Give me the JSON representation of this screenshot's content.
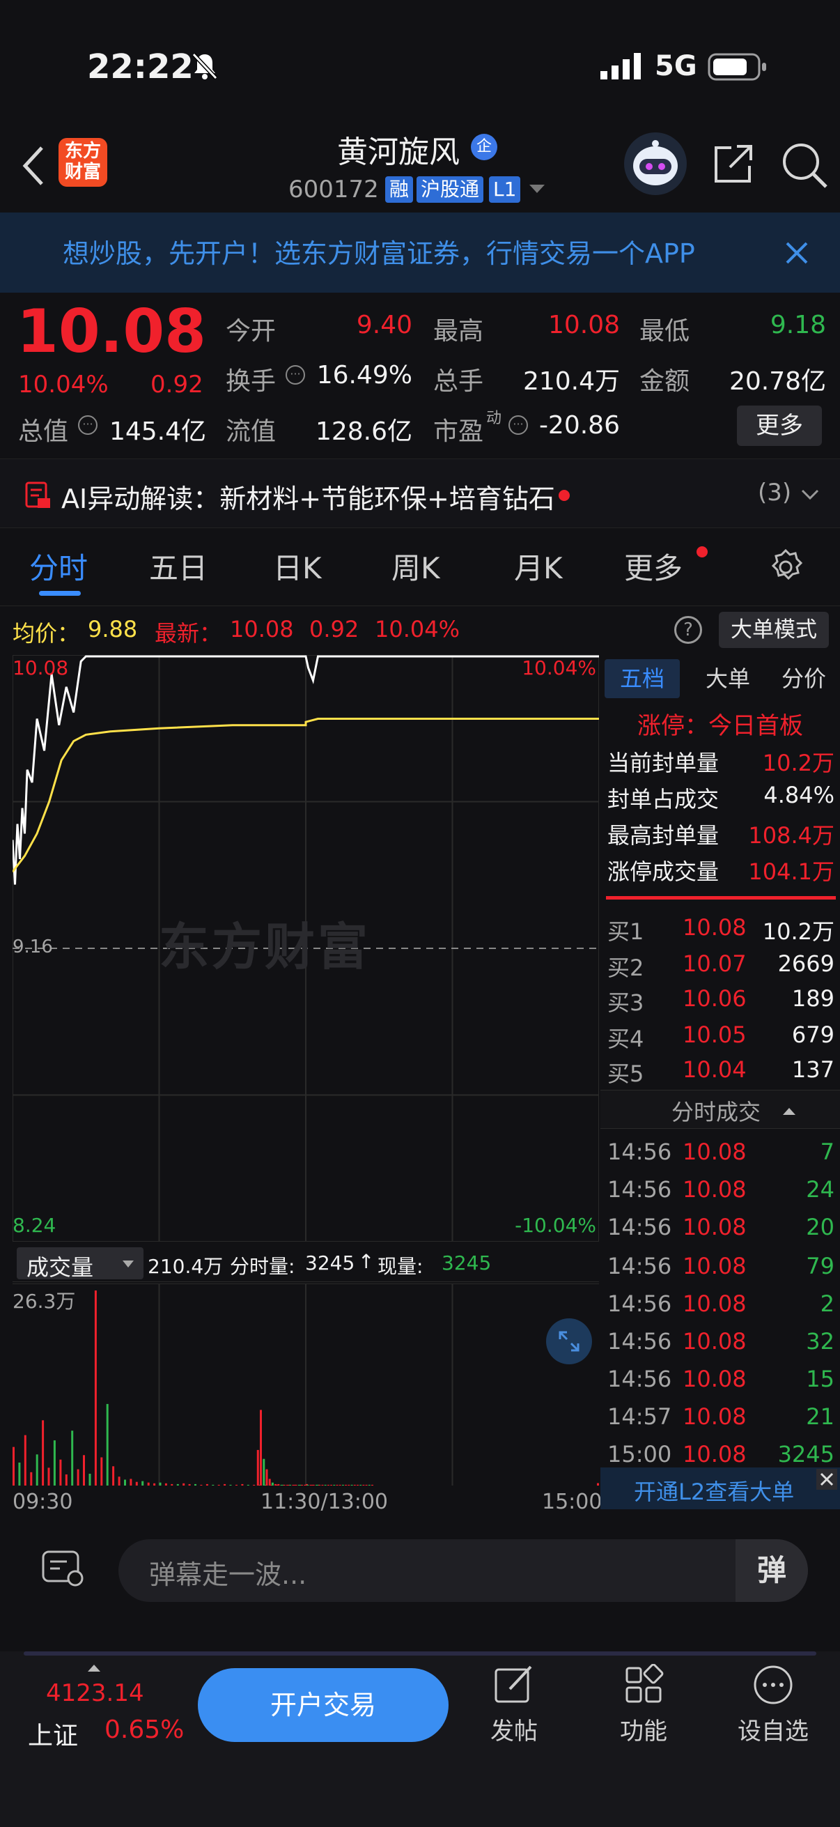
{
  "status": {
    "time": "22:22",
    "network": "5G"
  },
  "nav": {
    "logo_line1": "东方",
    "logo_line2": "财富",
    "title": "黄河旋风",
    "title_badge": "企",
    "code": "600172",
    "tags": [
      "融",
      "沪股通",
      "L1"
    ]
  },
  "banner": {
    "text": "想炒股，先开户！选东方财富证券，行情交易一个APP"
  },
  "quote": {
    "price": "10.08",
    "change_pct": "10.04%",
    "change": "0.92",
    "fields": [
      {
        "label": "今开",
        "value": "9.40"
      },
      {
        "label": "最高",
        "value": "10.08"
      },
      {
        "label": "最低",
        "value": "9.18"
      },
      {
        "label": "换手",
        "value": "16.49%"
      },
      {
        "label": "总手",
        "value": "210.4万"
      },
      {
        "label": "金额",
        "value": "20.78亿"
      },
      {
        "label": "总值",
        "value": "145.4亿"
      },
      {
        "label": "流值",
        "value": "128.6亿"
      },
      {
        "label": "市盈",
        "value": "-20.86"
      }
    ],
    "pe_superscript": "动",
    "more_button": "更多"
  },
  "ai": {
    "text": "AI异动解读：新材料+节能环保+培育钻石",
    "count": "(3)"
  },
  "tabs": [
    "分时",
    "五日",
    "日K",
    "周K",
    "月K",
    "更多"
  ],
  "chart_info": {
    "avg_label": "均价：",
    "avg_value": "9.88",
    "latest_label": "最新：",
    "latest_value": "10.08",
    "latest_change": "0.92",
    "latest_pct": "10.04%",
    "mode_button": "大单模式"
  },
  "chart_labels": {
    "top_price": "10.08",
    "top_pct": "10.04%",
    "mid_price": "9.16",
    "bottom_price": "8.24",
    "bottom_pct": "-10.04%",
    "watermark": "东方财富"
  },
  "volume": {
    "selector": "成交量",
    "total": "210.4万",
    "minute_label": "分时量:",
    "minute_value": "3245",
    "current_label": "现量:",
    "current_value": "3245",
    "axis_max": "26.3万",
    "time_start": "09:30",
    "time_mid": "11:30/13:00",
    "time_end": "15:00"
  },
  "right_panel": {
    "tabs": [
      "五档",
      "大单",
      "分价"
    ],
    "limit_up": "涨停：今日首板",
    "stats": [
      {
        "label": "当前封单量",
        "value": "10.2万"
      },
      {
        "label": "封单占成交",
        "value": "4.84%"
      },
      {
        "label": "最高封单量",
        "value": "108.4万"
      },
      {
        "label": "涨停成交量",
        "value": "104.1万"
      }
    ],
    "bids": [
      {
        "label": "买1",
        "price": "10.08",
        "vol": "10.2万"
      },
      {
        "label": "买2",
        "price": "10.07",
        "vol": "2669"
      },
      {
        "label": "买3",
        "price": "10.06",
        "vol": "189"
      },
      {
        "label": "买4",
        "price": "10.05",
        "vol": "679"
      },
      {
        "label": "买5",
        "price": "10.04",
        "vol": "137"
      }
    ],
    "trades_header": "分时成交",
    "trades": [
      {
        "time": "14:56",
        "price": "10.08",
        "vol": "7"
      },
      {
        "time": "14:56",
        "price": "10.08",
        "vol": "24"
      },
      {
        "time": "14:56",
        "price": "10.08",
        "vol": "20"
      },
      {
        "time": "14:56",
        "price": "10.08",
        "vol": "79"
      },
      {
        "time": "14:56",
        "price": "10.08",
        "vol": "2"
      },
      {
        "time": "14:56",
        "price": "10.08",
        "vol": "32"
      },
      {
        "time": "14:56",
        "price": "10.08",
        "vol": "15"
      },
      {
        "time": "14:57",
        "price": "10.08",
        "vol": "21"
      },
      {
        "time": "15:00",
        "price": "10.08",
        "vol": "3245"
      }
    ],
    "l2_banner": "开通L2查看大单"
  },
  "danmu": {
    "placeholder": "弹幕走一波...",
    "send": "弹"
  },
  "footer": {
    "index_value": "4123.14",
    "index_name": "上证",
    "index_pct": "0.65%",
    "trade_button": "开户交易",
    "items": [
      "发帖",
      "功能",
      "设自选"
    ]
  },
  "colors": {
    "up": "#f0212c",
    "down": "#2fb84f",
    "avg_line": "#ffe14a",
    "price_line": "#ffffff",
    "accent": "#2b7bf0"
  },
  "chart_data": [
    {
      "type": "line",
      "title": "分时",
      "x_range": [
        "09:30",
        "15:00"
      ],
      "ylim": [
        8.24,
        10.08
      ],
      "reference": 9.16,
      "series": [
        {
          "name": "最新",
          "x": [
            "09:30",
            "09:31",
            "09:32",
            "09:33",
            "09:34",
            "09:35",
            "09:36",
            "09:38",
            "09:40",
            "09:43",
            "09:46",
            "09:49",
            "09:52",
            "09:55",
            "09:58",
            "10:00",
            "10:03",
            "10:05",
            "10:10",
            "10:30",
            "11:00",
            "11:30",
            "13:00",
            "13:01",
            "13:03",
            "13:05",
            "14:00",
            "15:00"
          ],
          "values": [
            9.5,
            9.36,
            9.55,
            9.44,
            9.6,
            9.52,
            9.72,
            9.68,
            9.88,
            9.78,
            10.02,
            9.86,
            9.98,
            9.9,
            10.06,
            10.08,
            10.08,
            10.08,
            10.08,
            10.08,
            10.08,
            10.08,
            10.08,
            10.04,
            10.0,
            10.08,
            10.08,
            10.08
          ]
        },
        {
          "name": "均价",
          "x": [
            "09:30",
            "09:35",
            "09:40",
            "09:45",
            "09:50",
            "09:55",
            "10:00",
            "10:10",
            "10:30",
            "11:00",
            "11:30",
            "13:00",
            "13:05",
            "14:00",
            "15:00"
          ],
          "values": [
            9.4,
            9.45,
            9.52,
            9.62,
            9.75,
            9.81,
            9.83,
            9.84,
            9.85,
            9.86,
            9.86,
            9.87,
            9.88,
            9.88,
            9.88
          ]
        }
      ]
    },
    {
      "type": "bar",
      "title": "成交量",
      "ylim": [
        0,
        263000
      ],
      "x_range": [
        "09:30",
        "15:00"
      ],
      "series": [
        {
          "name": "成交量",
          "values": [
            52000,
            31000,
            68000,
            18000,
            42000,
            88000,
            24000,
            61000,
            35000,
            15000,
            74000,
            22000,
            41000,
            16000,
            263000,
            38000,
            110000,
            26000,
            12000,
            8000,
            9000,
            5000,
            6000,
            4000,
            3000,
            4000,
            3000,
            2000,
            2000,
            3000,
            2000,
            2000,
            1000,
            2000,
            1000,
            1000,
            2000,
            1000,
            1000,
            2000,
            1000,
            1000,
            1000,
            1000,
            1000,
            1000,
            1000,
            1000,
            1000,
            1000,
            2000,
            1000,
            1000,
            48000,
            102000,
            36000,
            22000,
            9000,
            4000,
            2000,
            2000,
            1000,
            1000,
            1000,
            1000,
            1000,
            1000,
            1000,
            1000,
            1000,
            1000,
            1000,
            1000,
            1000,
            1000,
            1000,
            1000,
            1000,
            1000,
            1000,
            1000,
            1000,
            1000,
            1000,
            1000,
            1000,
            1000,
            1000,
            1000,
            1000,
            1000,
            1000,
            1000,
            3245
          ]
        }
      ]
    }
  ]
}
